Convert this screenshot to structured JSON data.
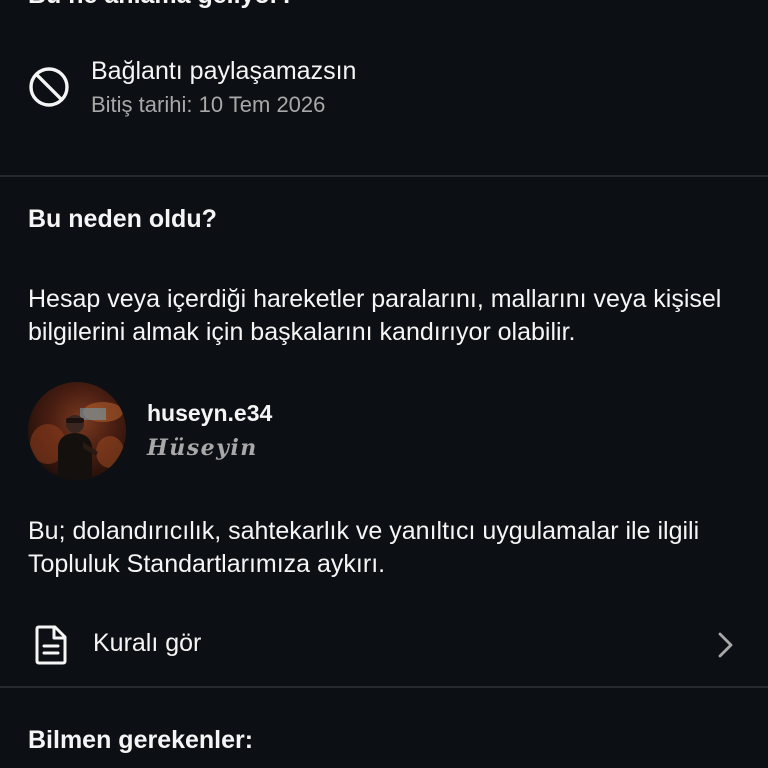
{
  "top_heading": "Bu ne anlama geliyor?",
  "restriction": {
    "icon": "ban-icon",
    "title": "Bağlantı paylaşamazsın",
    "subtitle": "Bitiş tarihi: 10 Tem 2026"
  },
  "why": {
    "heading": "Bu neden oldu?",
    "reason": "Hesap veya içerdiği hareketler paralarını, mallarını veya kişisel bilgilerini almak için başkalarını kandırıyor olabilir."
  },
  "account": {
    "username": "huseyn.e34",
    "display_name": "Hüseyin"
  },
  "policy": {
    "text": "Bu; dolandırıcılık, sahtekarlık ve yanıltıcı uygulamalar ile ilgili Topluluk Standartlarımıza aykırı."
  },
  "rule_link": {
    "icon": "document-icon",
    "label": "Kuralı gör",
    "chevron": "chevron-right-icon"
  },
  "know": {
    "heading": "Bilmen gerekenler:"
  },
  "colors": {
    "background": "#0c1014",
    "primary_text": "#f5f5f5",
    "secondary_text": "#a8a8a8",
    "divider": "#262a30"
  }
}
